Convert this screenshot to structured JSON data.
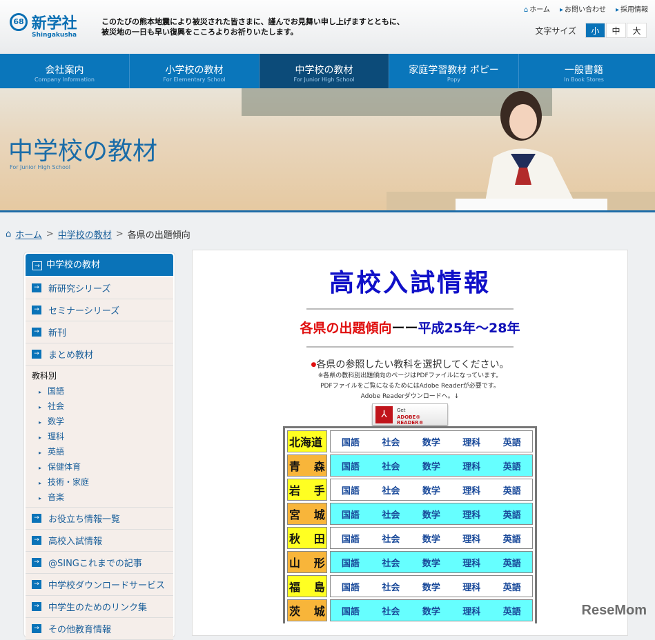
{
  "header": {
    "logo_text": "新学社",
    "logo_mark": "68",
    "logo_en": "Shingakusha",
    "notice": [
      "このたびの熊本地震により被災された皆さまに、謹んでお見舞い申し上げますとともに、",
      "被災地の一日も早い復興をこころよりお祈りいたします。"
    ],
    "top_links": [
      "ホーム",
      "お問い合わせ",
      "採用情報"
    ],
    "font_size_label": "文字サイズ",
    "font_sizes": [
      "小",
      "中",
      "大"
    ]
  },
  "nav": [
    {
      "jp": "会社案内",
      "en": "Company Information"
    },
    {
      "jp": "小学校の教材",
      "en": "For Elementary School"
    },
    {
      "jp": "中学校の教材",
      "en": "For Junior High School"
    },
    {
      "jp": "家庭学習教材 ポピー",
      "en": "Popy"
    },
    {
      "jp": "一般書籍",
      "en": "In Book Stores"
    }
  ],
  "hero": {
    "title": "中学校の教材",
    "subtitle": "For Junior High School"
  },
  "breadcrumb": [
    "ホーム",
    "中学校の教材",
    "各県の出題傾向"
  ],
  "sidebar": {
    "head": "中学校の教材",
    "items_top": [
      "新研究シリーズ",
      "セミナーシリーズ",
      "新刊",
      "まとめ教材"
    ],
    "category_title": "教科別",
    "categories": [
      "国語",
      "社会",
      "数学",
      "理科",
      "英語",
      "保健体育",
      "技術・家庭",
      "音楽"
    ],
    "items_bottom": [
      "お役立ち情報一覧",
      "高校入試情報",
      "@SINGこれまでの記事",
      "中学校ダウンロードサービス",
      "中学生のためのリンク集",
      "その他教育情報"
    ]
  },
  "main": {
    "title": "高校入試情報",
    "heading_red": "各県の出題傾向",
    "heading_dash": "ーー",
    "heading_blue": "平成25年〜28年",
    "instruction": "各県の参照したい教科を選択してください。",
    "notes": [
      "※各県の教科別出題傾向のページはPDFファイルになっています。",
      "PDFファイルをご覧になるためにはAdobe Readerが必要です。",
      "Adobe Readerダウンロードへ。↓"
    ],
    "adobe_get": "Get",
    "adobe_reader": "ADOBE® READER®",
    "subjects": [
      "国語",
      "社会",
      "数学",
      "理科",
      "英語"
    ],
    "prefectures": [
      [
        "北海道"
      ],
      [
        "青",
        "森"
      ],
      [
        "岩",
        "手"
      ],
      [
        "宮",
        "城"
      ],
      [
        "秋",
        "田"
      ],
      [
        "山",
        "形"
      ],
      [
        "福",
        "島"
      ],
      [
        "茨",
        "城"
      ]
    ]
  },
  "watermark": "ReseMom"
}
